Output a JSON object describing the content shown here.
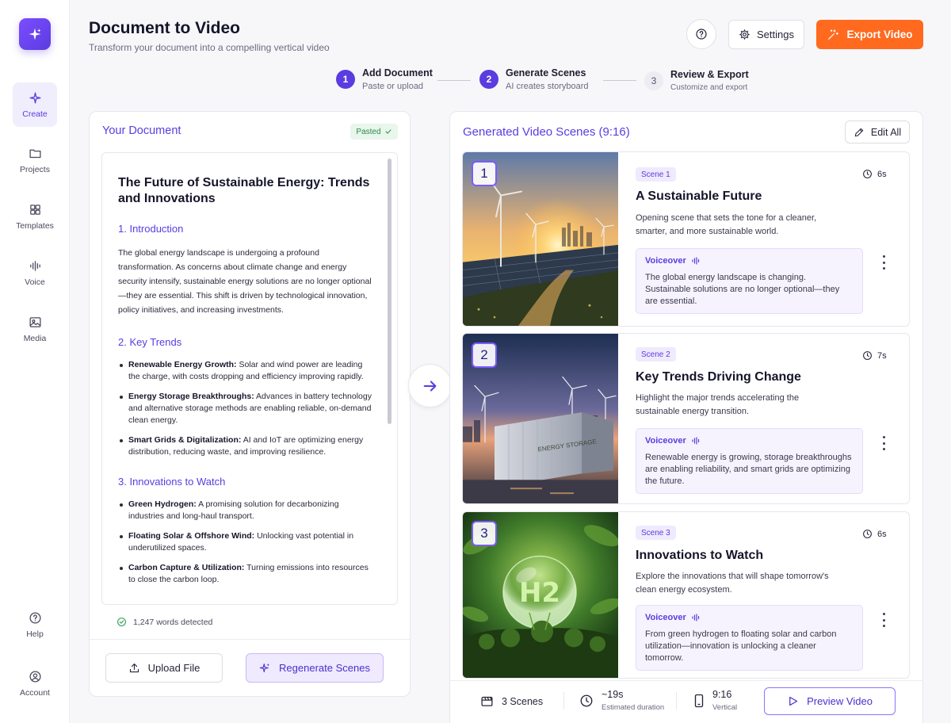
{
  "nav": {
    "items": [
      {
        "label": "Create"
      },
      {
        "label": "Projects"
      },
      {
        "label": "Templates"
      },
      {
        "label": "Voice"
      },
      {
        "label": "Media"
      },
      {
        "label": "Help"
      },
      {
        "label": "Account"
      }
    ]
  },
  "header": {
    "title": "Document to Video",
    "subtitle": "Transform your document into a compelling vertical video",
    "settings_label": "Settings",
    "export_label": "Export Video"
  },
  "steps": [
    {
      "num": "1",
      "title": "Add Document",
      "sub": "Paste or upload"
    },
    {
      "num": "2",
      "title": "Generate Scenes",
      "sub": "AI creates storyboard"
    },
    {
      "num": "3",
      "title": "Review & Export",
      "sub": "Customize and export"
    }
  ],
  "document": {
    "panel_title": "Your Document",
    "status_badge": "Pasted",
    "title": "The Future of Sustainable Energy: Trends and Innovations",
    "sections": [
      {
        "heading": "1. Introduction",
        "paragraph": "The global energy landscape is undergoing a profound transformation. As concerns about climate change and energy security intensify, sustainable energy solutions are no longer optional—they are essential. This shift is driven by technological innovation, policy initiatives, and increasing investments."
      },
      {
        "heading": "2. Key Trends",
        "items": [
          {
            "term": "Renewable Energy Growth:",
            "text": "Solar and wind power are leading the charge, with costs dropping and efficiency improving rapidly."
          },
          {
            "term": "Energy Storage Breakthroughs:",
            "text": "Advances in battery technology and alternative storage methods are enabling reliable, on-demand clean energy."
          },
          {
            "term": "Smart Grids & Digitalization:",
            "text": "AI and IoT are optimizing energy distribution, reducing waste, and improving resilience."
          }
        ]
      },
      {
        "heading": "3. Innovations to Watch",
        "items": [
          {
            "term": "Green Hydrogen:",
            "text": "A promising solution for decarbonizing industries and long-haul transport."
          },
          {
            "term": "Floating Solar & Offshore Wind:",
            "text": "Unlocking vast potential in underutilized spaces."
          },
          {
            "term": "Carbon Capture & Utilization:",
            "text": "Turning emissions into resources to close the carbon loop."
          }
        ]
      }
    ],
    "word_count": "1,247 words detected",
    "upload_label": "Upload File",
    "regenerate_label": "Regenerate Scenes"
  },
  "scenes_panel": {
    "title": "Generated Video Scenes (9:16)",
    "edit_all_label": "Edit All",
    "scenes": [
      {
        "num": "1",
        "badge": "Scene 1",
        "duration": "6s",
        "title": "A Sustainable Future",
        "description": "Opening scene that sets the tone for a cleaner, smarter, and more sustainable world.",
        "voiceover_label": "Voiceover",
        "voiceover": "The global energy landscape is changing. Sustainable solutions are no longer optional—they are essential."
      },
      {
        "num": "2",
        "badge": "Scene 2",
        "duration": "7s",
        "title": "Key Trends Driving Change",
        "description": "Highlight the major trends accelerating the sustainable energy transition.",
        "voiceover_label": "Voiceover",
        "voiceover": "Renewable energy is growing, storage breakthroughs are enabling reliability, and smart grids are optimizing the future.",
        "image_text": "ENERGY STORAGE"
      },
      {
        "num": "3",
        "badge": "Scene 3",
        "duration": "6s",
        "title": "Innovations to Watch",
        "description": "Explore the innovations that will shape tomorrow's clean energy ecosystem.",
        "voiceover_label": "Voiceover",
        "voiceover": "From green hydrogen to floating solar and carbon utilization—innovation is unlocking a cleaner tomorrow.",
        "image_text": "H2"
      }
    ]
  },
  "footer": {
    "scenes_count": "3 Scenes",
    "duration": "~19s",
    "duration_label": "Estimated duration",
    "aspect": "9:16",
    "aspect_label": "Vertical",
    "preview_label": "Preview Video"
  }
}
